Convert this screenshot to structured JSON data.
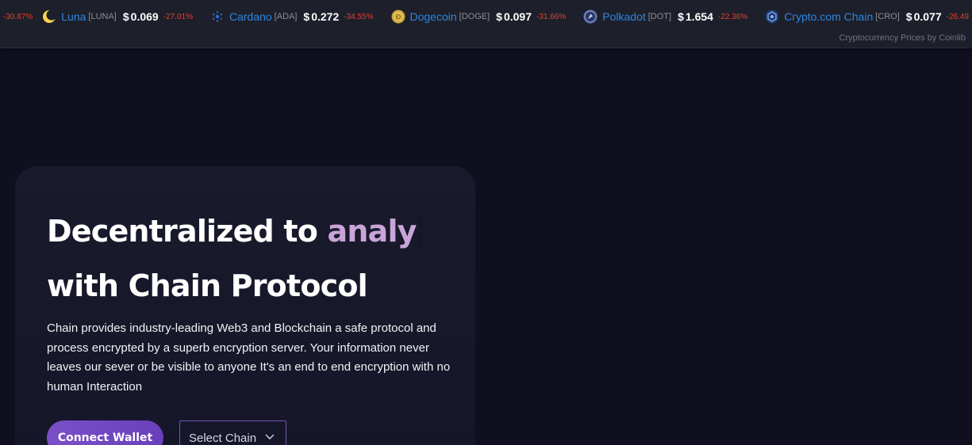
{
  "ticker": {
    "lead_change": "-30.87%",
    "coins": [
      {
        "name": "Luna",
        "symbol": "[LUNA]",
        "currency": "$",
        "price": "0.069",
        "change": "-27.01%",
        "icon": "luna-icon",
        "color": "#f9d34c"
      },
      {
        "name": "Cardano",
        "symbol": "[ADA]",
        "currency": "$",
        "price": "0.272",
        "change": "-34.55%",
        "icon": "cardano-icon",
        "color": "#2a6fd6"
      },
      {
        "name": "Dogecoin",
        "symbol": "[DOGE]",
        "currency": "$",
        "price": "0.097",
        "change": "-31.66%",
        "icon": "dogecoin-icon",
        "color": "#c9a23a"
      },
      {
        "name": "Polkadot",
        "symbol": "[DOT]",
        "currency": "$",
        "price": "1.654",
        "change": "-22.36%",
        "icon": "polkadot-icon",
        "color": "#6b7db8"
      },
      {
        "name": "Crypto.com Chain",
        "symbol": "[CRO]",
        "currency": "$",
        "price": "0.077",
        "change": "-26.49",
        "icon": "cro-icon",
        "color": "#1b3a73"
      }
    ],
    "credit": "Cryptocurrency Prices by Coinlib"
  },
  "hero": {
    "title_part1": "Decentralized to ",
    "title_accent": "analy",
    "title_line2": "with Chain Protocol",
    "description": "Chain provides industry-leading Web3 and Blockchain a safe protocol and process encrypted by a superb encryption server. Your information never leaves our sever or be visible to anyone It's an end to end encryption with no human Interaction",
    "connect_label": "Connect Wallet",
    "select_label": "Select Chain"
  },
  "colors": {
    "background": "#0f0f1f",
    "accent": "#c9a4d8",
    "button": "#7a4fc8",
    "change_negative": "#e0442e",
    "coin_name": "#2e86de"
  }
}
